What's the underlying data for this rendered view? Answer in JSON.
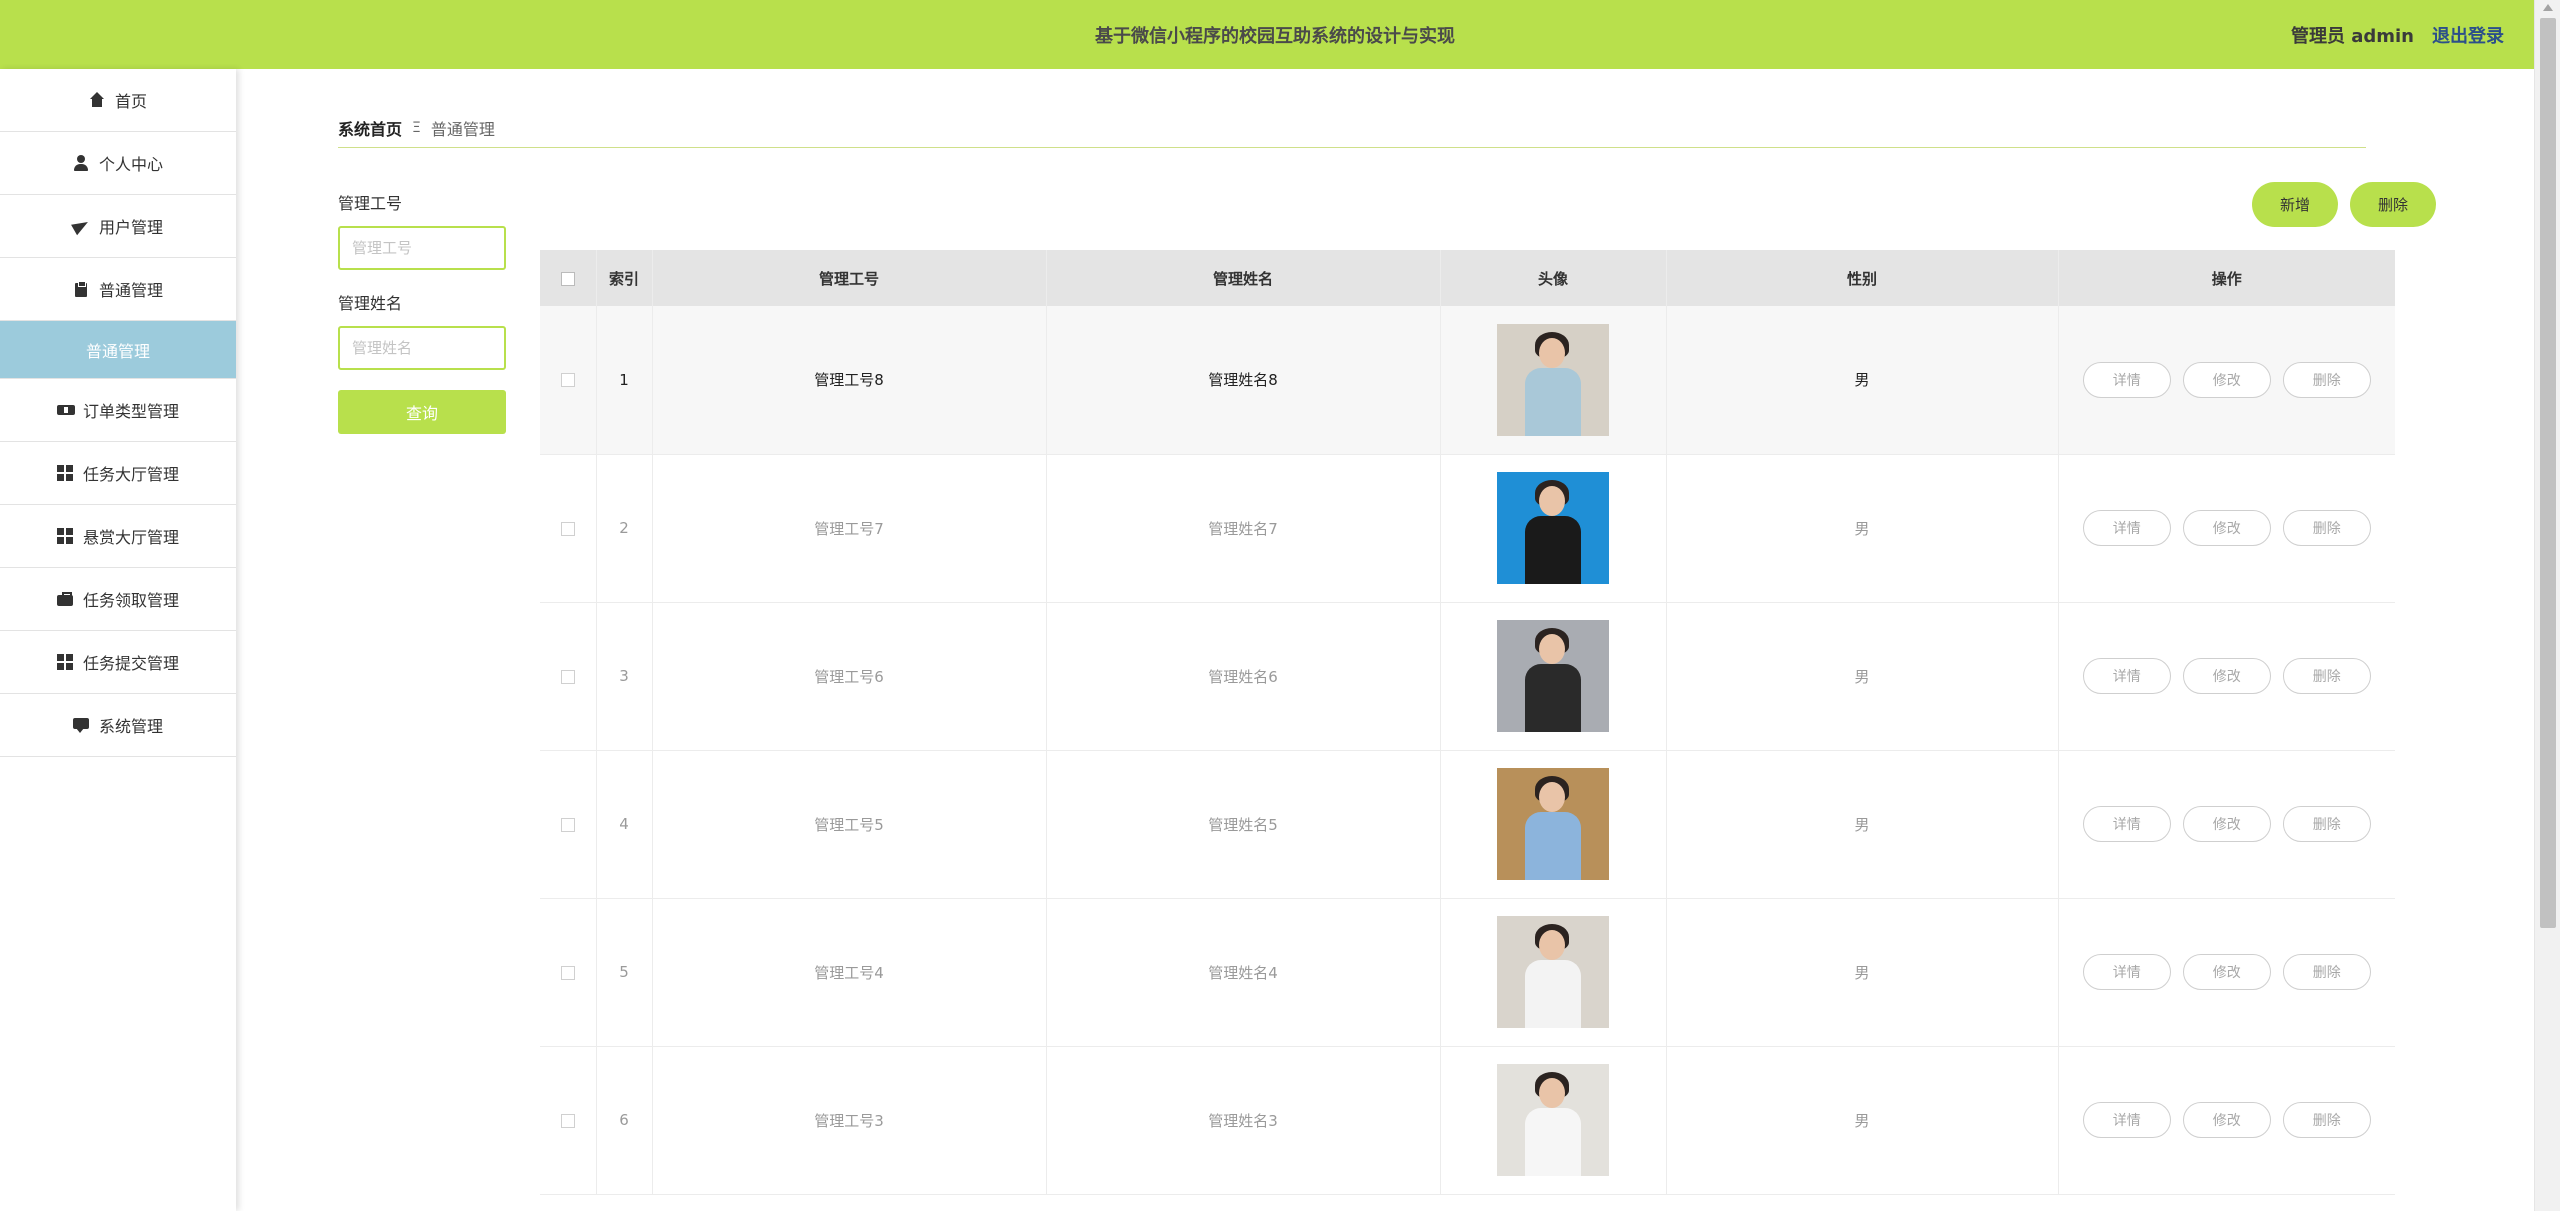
{
  "header": {
    "title": "基于微信小程序的校园互助系统的设计与实现",
    "user": "管理员 admin",
    "logout": "退出登录",
    "bg_color": "#b8e04c"
  },
  "sidebar": {
    "items": [
      {
        "label": "首页",
        "icon": "home-icon"
      },
      {
        "label": "个人中心",
        "icon": "user-icon"
      },
      {
        "label": "用户管理",
        "icon": "paper-plane-icon"
      },
      {
        "label": "普通管理",
        "icon": "clipboard-icon"
      },
      {
        "label": "普通管理",
        "icon": "",
        "active": true
      },
      {
        "label": "订单类型管理",
        "icon": "ticket-icon"
      },
      {
        "label": "任务大厅管理",
        "icon": "grid-icon"
      },
      {
        "label": "悬赏大厅管理",
        "icon": "grid-icon"
      },
      {
        "label": "任务领取管理",
        "icon": "briefcase-icon"
      },
      {
        "label": "任务提交管理",
        "icon": "grid-icon"
      },
      {
        "label": "系统管理",
        "icon": "chat-icon"
      }
    ],
    "active_color": "#9ccbdc"
  },
  "breadcrumb": {
    "home": "系统首页",
    "separator": "Ξ",
    "current": "普通管理"
  },
  "filters": {
    "field1_label": "管理工号",
    "field1_placeholder": "管理工号",
    "field2_label": "管理姓名",
    "field2_placeholder": "管理姓名",
    "search_label": "查询"
  },
  "actions": {
    "add_label": "新增",
    "delete_label": "删除"
  },
  "table": {
    "headers": [
      "索引",
      "管理工号",
      "管理姓名",
      "头像",
      "性别",
      "操作"
    ],
    "rows": [
      {
        "index": "1",
        "id": "管理工号8",
        "name": "管理姓名8",
        "gender": "男",
        "avatar_color": "#a9c8d8"
      },
      {
        "index": "2",
        "id": "管理工号7",
        "name": "管理姓名7",
        "gender": "男",
        "avatar_color": "#1a1a1a"
      },
      {
        "index": "3",
        "id": "管理工号6",
        "name": "管理姓名6",
        "gender": "男",
        "avatar_color": "#2a2a2a"
      },
      {
        "index": "4",
        "id": "管理工号5",
        "name": "管理姓名5",
        "gender": "男",
        "avatar_color": "#8cb4dc"
      },
      {
        "index": "5",
        "id": "管理工号4",
        "name": "管理姓名4",
        "gender": "男",
        "avatar_color": "#f3f3f3"
      },
      {
        "index": "6",
        "id": "管理工号3",
        "name": "管理姓名3",
        "gender": "男",
        "avatar_color": "#f6f6f6"
      }
    ],
    "row_actions": {
      "detail": "详情",
      "edit": "修改",
      "delete": "删除"
    }
  }
}
